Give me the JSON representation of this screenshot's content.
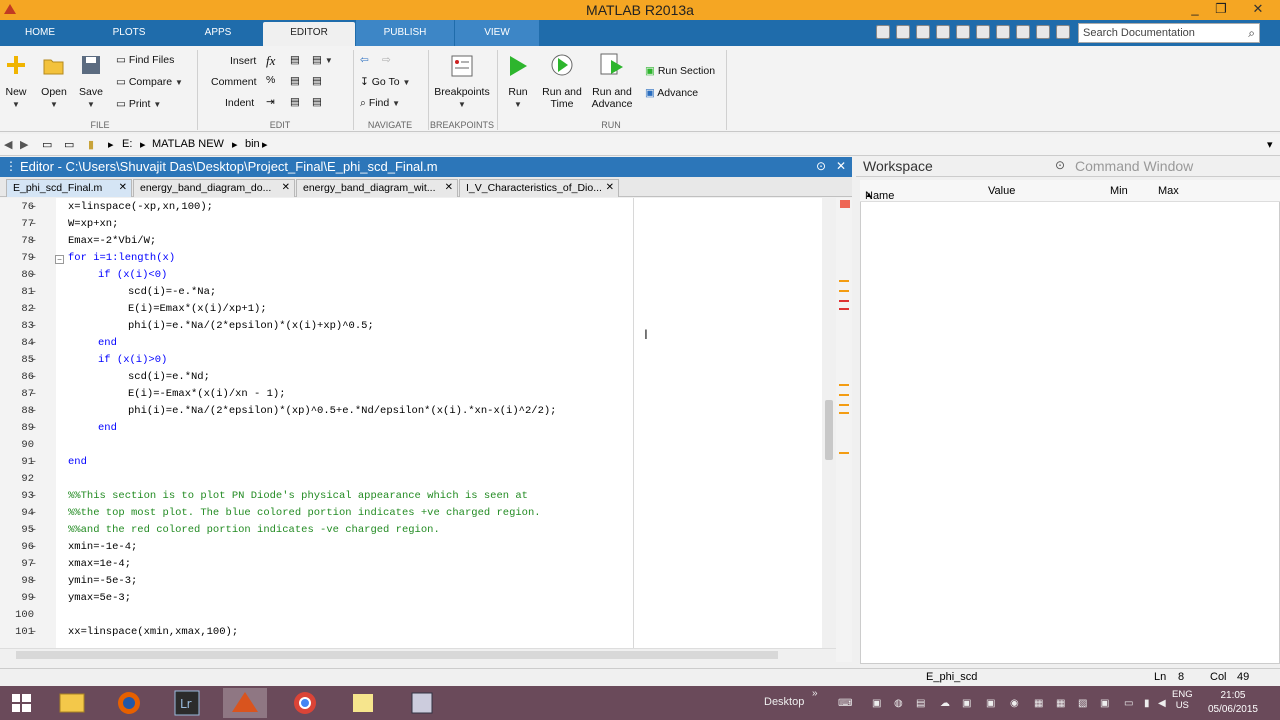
{
  "window": {
    "title": "MATLAB R2013a"
  },
  "tabs": [
    {
      "label": "HOME"
    },
    {
      "label": "PLOTS"
    },
    {
      "label": "APPS"
    },
    {
      "label": "EDITOR"
    },
    {
      "label": "PUBLISH"
    },
    {
      "label": "VIEW"
    }
  ],
  "search": {
    "placeholder": "Search Documentation"
  },
  "ribbon": {
    "file": {
      "new": "New",
      "open": "Open",
      "save": "Save",
      "find_files": "Find Files",
      "compare": "Compare",
      "print": "Print",
      "label": "FILE"
    },
    "edit": {
      "insert": "Insert",
      "comment": "Comment",
      "indent": "Indent",
      "fx": "fx",
      "label": "EDIT"
    },
    "navigate": {
      "goto": "Go To",
      "find": "Find",
      "label": "NAVIGATE"
    },
    "breakpoints": {
      "button": "Breakpoints",
      "label": "BREAKPOINTS"
    },
    "run": {
      "run": "Run",
      "run_time_1": "Run and",
      "run_time_2": "Time",
      "run_adv_1": "Run and",
      "run_adv_2": "Advance",
      "run_section": "Run Section",
      "advance": "Advance",
      "label": "RUN"
    }
  },
  "address": {
    "drive": "E:",
    "folder1": "MATLAB NEW",
    "folder2": "bin"
  },
  "editor": {
    "title": "Editor - C:\\Users\\Shuvajit Das\\Desktop\\Project_Final\\E_phi_scd_Final.m",
    "tabs": [
      {
        "label": "E_phi_scd_Final.m"
      },
      {
        "label": "energy_band_diagram_do..."
      },
      {
        "label": "energy_band_diagram_wit..."
      },
      {
        "label": "I_V_Characteristics_of_Dio..."
      }
    ]
  },
  "code": [
    {
      "n": "76",
      "t": "x=linspace(-xp,xn,100);",
      "i": 0,
      "k": ""
    },
    {
      "n": "77",
      "t": "W=xp+xn;",
      "i": 0,
      "k": ""
    },
    {
      "n": "78",
      "t": "Emax=-2*Vbi/W;",
      "i": 0,
      "k": ""
    },
    {
      "n": "79",
      "t": "for i=1:length(x)",
      "i": 0,
      "k": "kw"
    },
    {
      "n": "80",
      "t": "if (x(i)<0)",
      "i": 1,
      "k": "kw"
    },
    {
      "n": "81",
      "t": "scd(i)=-e.*Na;",
      "i": 2,
      "k": ""
    },
    {
      "n": "82",
      "t": "E(i)=Emax*(x(i)/xp+1);",
      "i": 2,
      "k": ""
    },
    {
      "n": "83",
      "t": "phi(i)=e.*Na/(2*epsilon)*(x(i)+xp)^0.5;",
      "i": 2,
      "k": ""
    },
    {
      "n": "84",
      "t": "end",
      "i": 1,
      "k": "kw"
    },
    {
      "n": "85",
      "t": "if (x(i)>0)",
      "i": 1,
      "k": "kw"
    },
    {
      "n": "86",
      "t": "scd(i)=e.*Nd;",
      "i": 2,
      "k": ""
    },
    {
      "n": "87",
      "t": "E(i)=-Emax*(x(i)/xn - 1);",
      "i": 2,
      "k": ""
    },
    {
      "n": "88",
      "t": "phi(i)=e.*Na/(2*epsilon)*(xp)^0.5+e.*Nd/epsilon*(x(i).*xn-x(i)^2/2);",
      "i": 2,
      "k": ""
    },
    {
      "n": "89",
      "t": "end",
      "i": 1,
      "k": "kw"
    },
    {
      "n": "90",
      "t": "",
      "i": 0,
      "k": ""
    },
    {
      "n": "91",
      "t": "end",
      "i": 0,
      "k": "kw"
    },
    {
      "n": "92",
      "t": "",
      "i": 0,
      "k": ""
    },
    {
      "n": "93",
      "t": "%%This section is to plot PN Diode's physical appearance which is seen at",
      "i": 0,
      "k": "cm"
    },
    {
      "n": "94",
      "t": "%%the top most plot. The blue colored portion indicates +ve charged region.",
      "i": 0,
      "k": "cm"
    },
    {
      "n": "95",
      "t": "%%and the red colored portion indicates -ve charged region.",
      "i": 0,
      "k": "cm"
    },
    {
      "n": "96",
      "t": "xmin=-1e-4;",
      "i": 0,
      "k": ""
    },
    {
      "n": "97",
      "t": "xmax=1e-4;",
      "i": 0,
      "k": ""
    },
    {
      "n": "98",
      "t": "ymin=-5e-3;",
      "i": 0,
      "k": ""
    },
    {
      "n": "99",
      "t": "ymax=5e-3;",
      "i": 0,
      "k": ""
    },
    {
      "n": "100",
      "t": "",
      "i": 0,
      "k": ""
    },
    {
      "n": "101",
      "t": "xx=linspace(xmin,xmax,100);",
      "i": 0,
      "k": ""
    }
  ],
  "workspace": {
    "title": "Workspace",
    "command_window": "Command Window",
    "columns": {
      "name": "Name",
      "value": "Value",
      "min": "Min",
      "max": "Max"
    }
  },
  "status": {
    "func": "E_phi_scd",
    "ln_label": "Ln",
    "ln": "8",
    "col_label": "Col",
    "col": "49"
  },
  "taskbar": {
    "desktop": "Desktop",
    "lang1": "ENG",
    "lang2": "US",
    "time": "21:05",
    "date": "05/06/2015"
  },
  "colors": {
    "accent": "#1f6cab",
    "editor_title": "#2c76b9",
    "keyword": "#0000ff",
    "comment": "#228b22",
    "titlebar": "#f5a623"
  }
}
